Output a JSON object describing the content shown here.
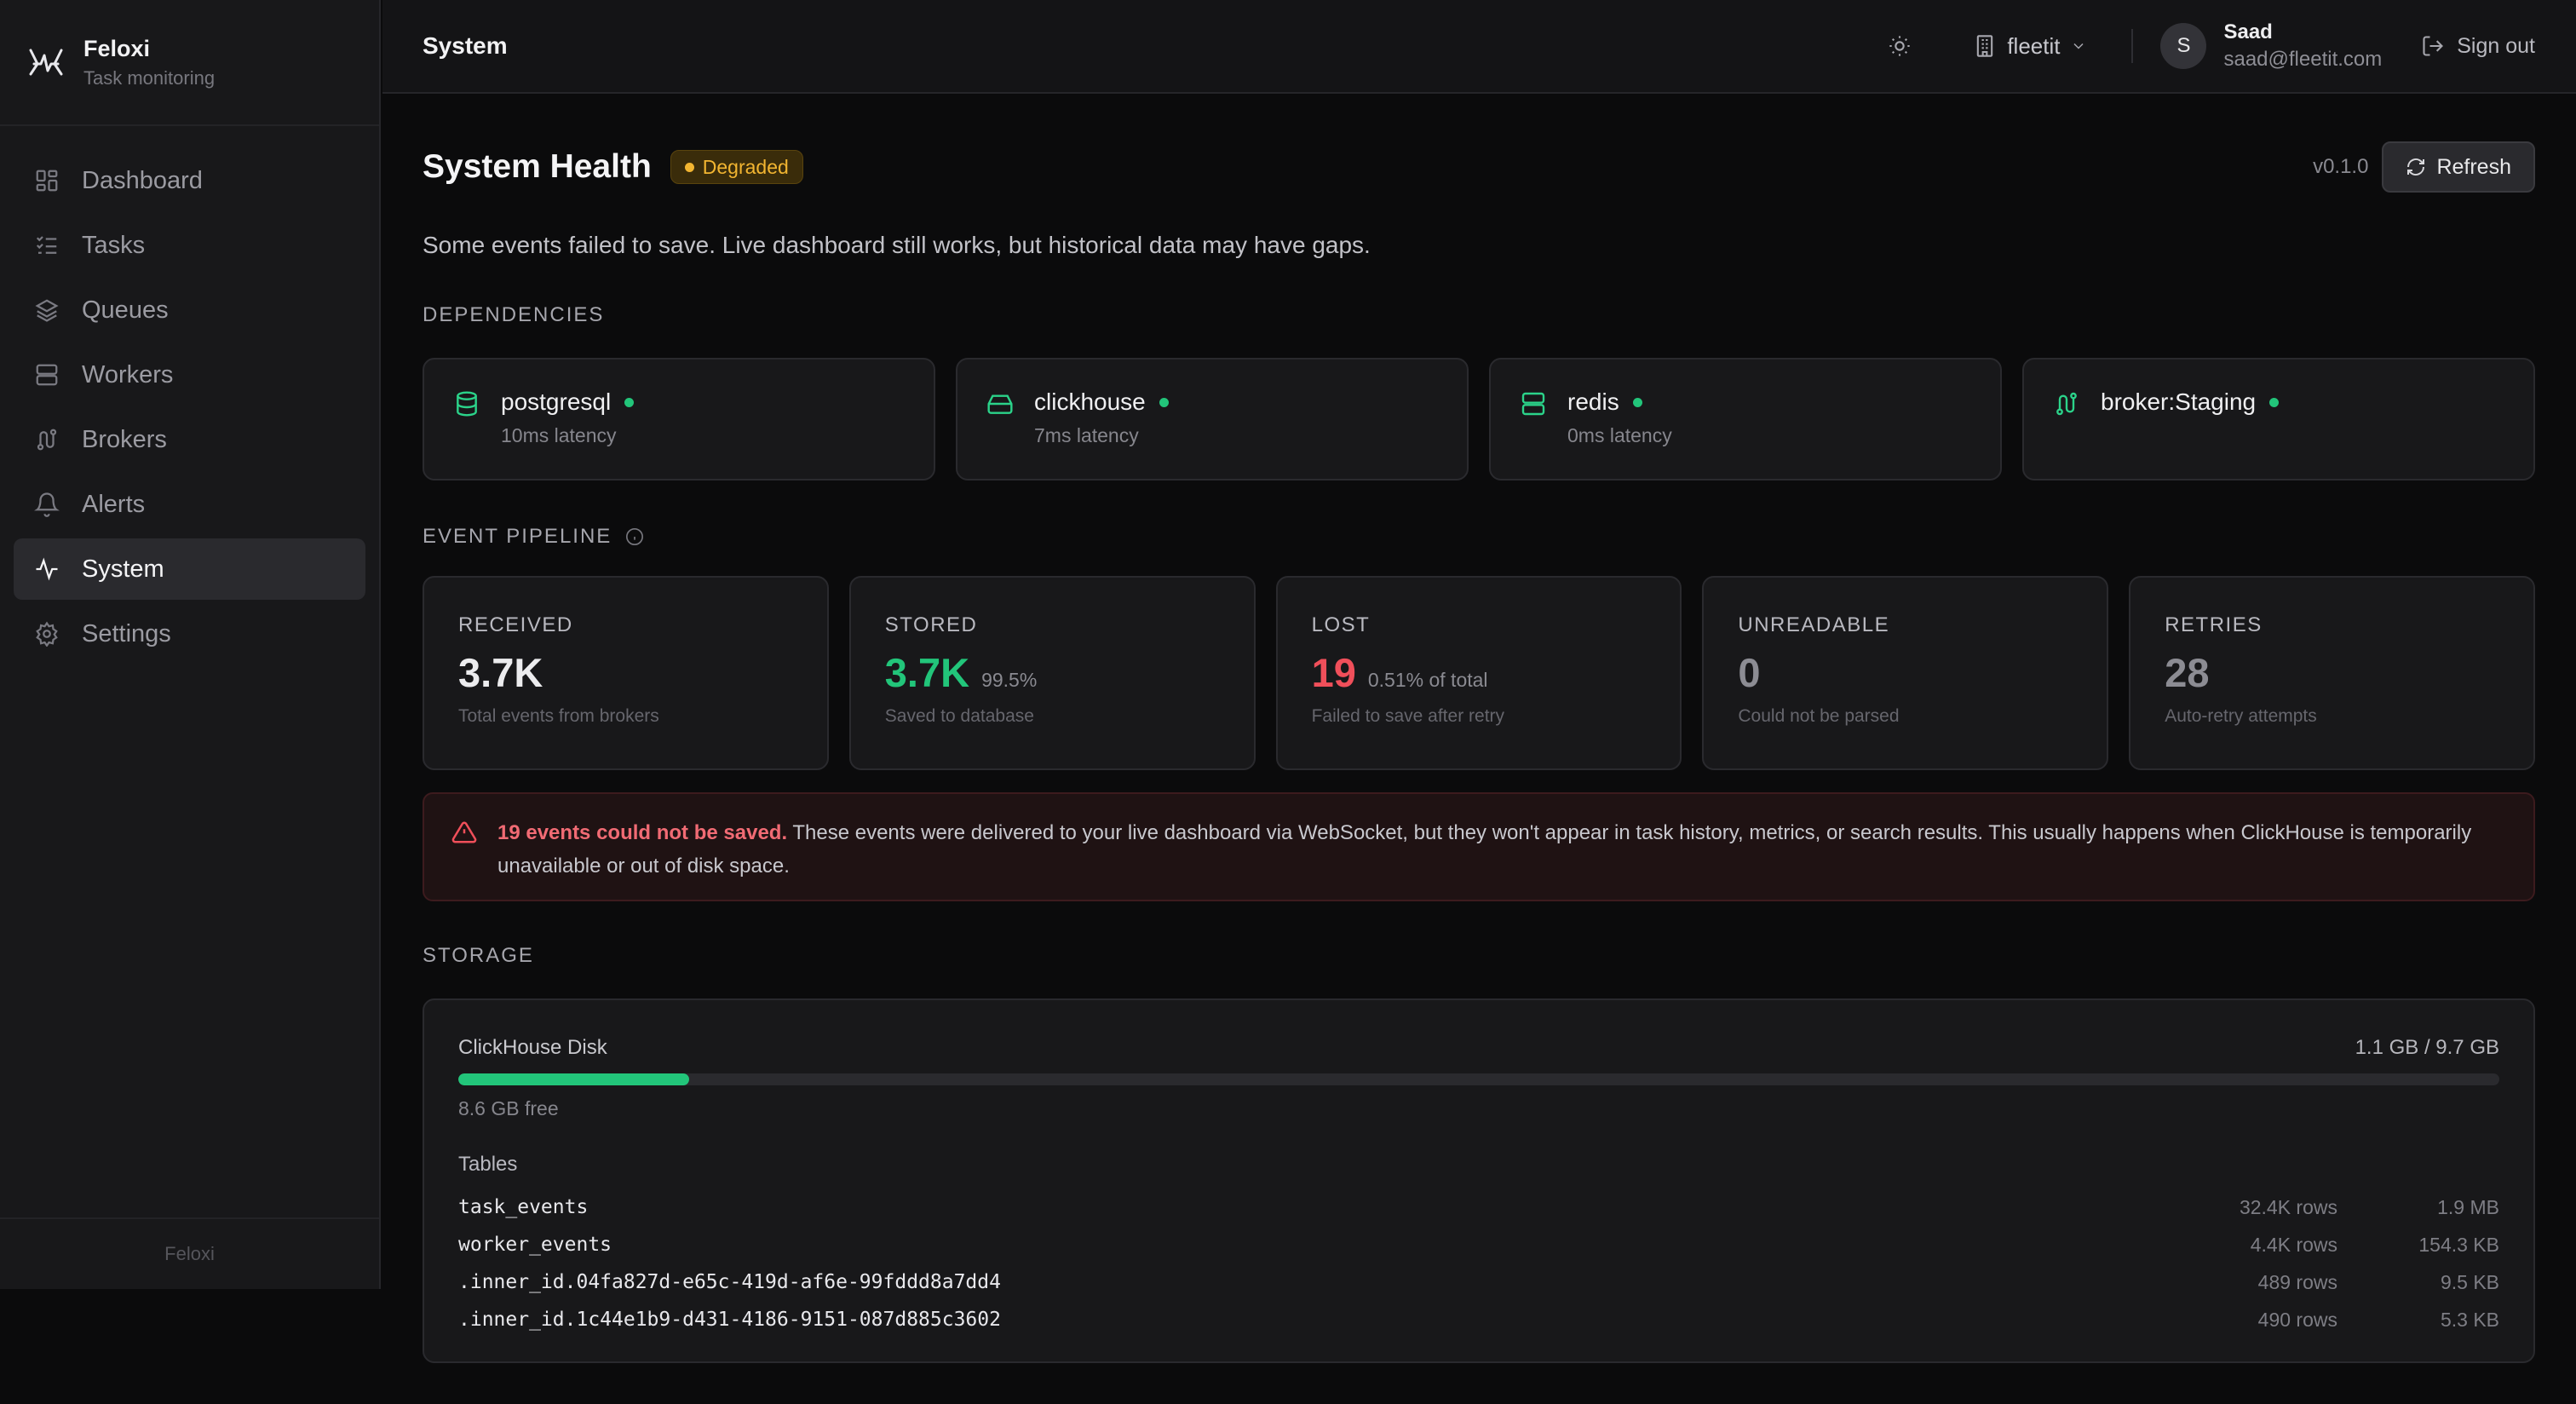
{
  "brand": {
    "name": "Feloxi",
    "subtitle": "Task monitoring",
    "footer": "Feloxi"
  },
  "sidebar": {
    "items": [
      {
        "label": "Dashboard",
        "icon": "dashboard-icon"
      },
      {
        "label": "Tasks",
        "icon": "tasks-icon"
      },
      {
        "label": "Queues",
        "icon": "layers-icon"
      },
      {
        "label": "Workers",
        "icon": "server-icon"
      },
      {
        "label": "Brokers",
        "icon": "route-icon"
      },
      {
        "label": "Alerts",
        "icon": "bell-icon"
      },
      {
        "label": "System",
        "icon": "activity-icon",
        "active": true
      },
      {
        "label": "Settings",
        "icon": "gear-icon"
      }
    ]
  },
  "topbar": {
    "title": "System",
    "org": "fleetit",
    "user": {
      "initial": "S",
      "name": "Saad",
      "email": "saad@fleetit.com"
    },
    "signout_label": "Sign out"
  },
  "header": {
    "title": "System Health",
    "status": "Degraded",
    "version": "v0.1.0",
    "refresh_label": "Refresh",
    "description": "Some events failed to save. Live dashboard still works, but historical data may have gaps."
  },
  "dependencies": {
    "label": "DEPENDENCIES",
    "items": [
      {
        "name": "postgresql",
        "latency": "10ms latency",
        "status": "ok",
        "icon": "database-icon"
      },
      {
        "name": "clickhouse",
        "latency": "7ms latency",
        "status": "ok",
        "icon": "hard-drive-icon"
      },
      {
        "name": "redis",
        "latency": "0ms latency",
        "status": "ok",
        "icon": "server-icon"
      },
      {
        "name": "broker:Staging",
        "latency": "",
        "status": "ok",
        "icon": "route-icon"
      }
    ]
  },
  "pipeline": {
    "label": "EVENT PIPELINE",
    "stats": [
      {
        "label": "RECEIVED",
        "value": "3.7K",
        "extra": "",
        "desc": "Total events from brokers"
      },
      {
        "label": "STORED",
        "value": "3.7K",
        "extra": "99.5%",
        "desc": "Saved to database"
      },
      {
        "label": "LOST",
        "value": "19",
        "extra": "0.51% of total",
        "desc": "Failed to save after retry"
      },
      {
        "label": "UNREADABLE",
        "value": "0",
        "extra": "",
        "desc": "Could not be parsed"
      },
      {
        "label": "RETRIES",
        "value": "28",
        "extra": "",
        "desc": "Auto-retry attempts"
      }
    ]
  },
  "alert": {
    "strong": "19 events could not be saved.",
    "text": " These events were delivered to your live dashboard via WebSocket, but they won't appear in task history, metrics, or search results. This usually happens when ClickHouse is temporarily unavailable or out of disk space."
  },
  "storage": {
    "label": "STORAGE",
    "disk_label": "ClickHouse Disk",
    "disk_usage": "1.1 GB / 9.7 GB",
    "disk_used_fraction": 0.113,
    "disk_free": "8.6 GB free",
    "tables_label": "Tables",
    "tables": [
      {
        "name": "task_events",
        "rows": "32.4K rows",
        "size": "1.9 MB"
      },
      {
        "name": "worker_events",
        "rows": "4.4K rows",
        "size": "154.3 KB"
      },
      {
        "name": ".inner_id.04fa827d-e65c-419d-af6e-99fddd8a7dd4",
        "rows": "489 rows",
        "size": "9.5 KB"
      },
      {
        "name": ".inner_id.1c44e1b9-d431-4186-9151-087d885c3602",
        "rows": "490 rows",
        "size": "5.3 KB"
      }
    ]
  },
  "colors": {
    "accent_green": "#22c57a",
    "warning": "#f2b531",
    "danger": "#f04f5a"
  }
}
